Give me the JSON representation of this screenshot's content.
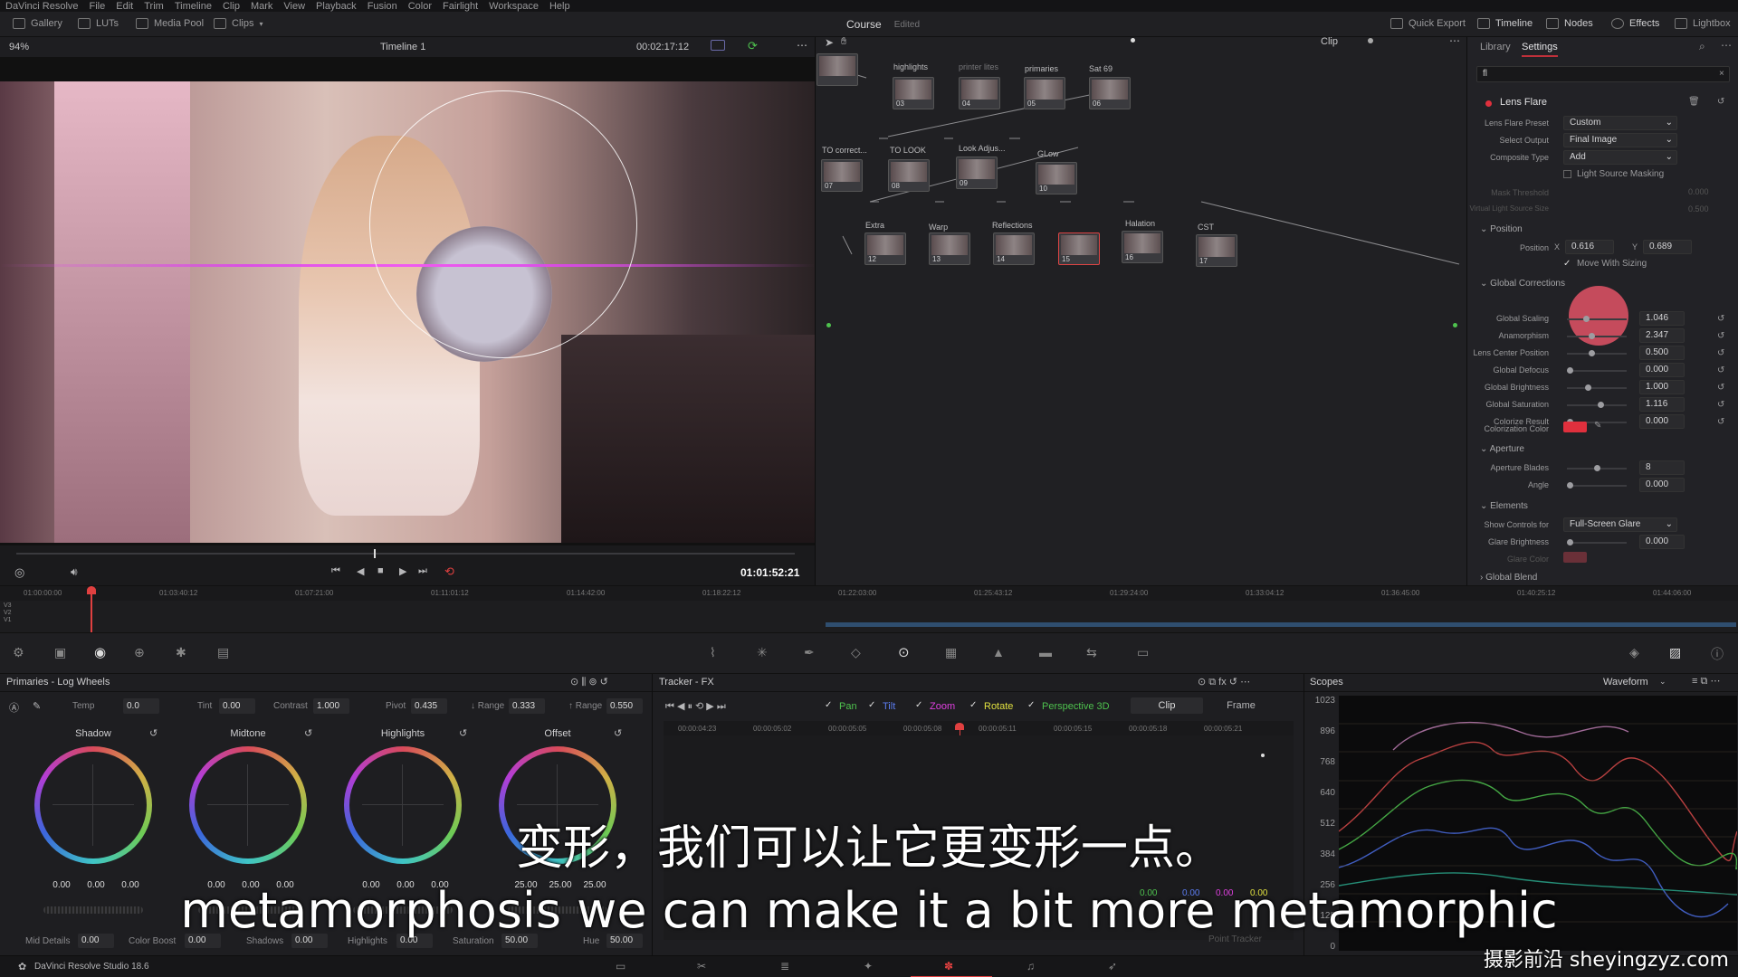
{
  "menu": [
    "DaVinci Resolve",
    "File",
    "Edit",
    "Trim",
    "Timeline",
    "Clip",
    "Mark",
    "View",
    "Playback",
    "Fusion",
    "Color",
    "Fairlight",
    "Workspace",
    "Help"
  ],
  "topbar": {
    "gallery": "Gallery",
    "luts": "LUTs",
    "media_pool": "Media Pool",
    "clips": "Clips",
    "project": "Course",
    "edited": "Edited",
    "quick_export": "Quick Export",
    "timeline": "Timeline",
    "nodes": "Nodes",
    "effects": "Effects",
    "lightbox": "Lightbox"
  },
  "viewer": {
    "zoom": "94%",
    "timeline_name": "Timeline 1",
    "timecode": "00:02:17:12",
    "clip_mode": "Clip",
    "playhead_tc": "01:01:52:21"
  },
  "nodes": [
    {
      "num": "03",
      "label": "highlights"
    },
    {
      "num": "04",
      "label": "printer lites"
    },
    {
      "num": "05",
      "label": "primaries"
    },
    {
      "num": "06",
      "label": "Sat 69"
    },
    {
      "num": "07",
      "label": "TO correct..."
    },
    {
      "num": "08",
      "label": "TO LOOK"
    },
    {
      "num": "09",
      "label": "Look Adjus..."
    },
    {
      "num": "10",
      "label": "GLow"
    },
    {
      "num": "12",
      "label": "Extra"
    },
    {
      "num": "13",
      "label": "Warp"
    },
    {
      "num": "14",
      "label": "Reflections"
    },
    {
      "num": "15",
      "label": ""
    },
    {
      "num": "16",
      "label": "Halation"
    },
    {
      "num": "17",
      "label": "CST"
    }
  ],
  "inspector": {
    "tab_library": "Library",
    "tab_settings": "Settings",
    "search": "fl",
    "effect": "Lens Flare",
    "preset_label": "Lens Flare Preset",
    "preset": "Custom",
    "output_label": "Select Output",
    "output": "Final Image",
    "composite_label": "Composite Type",
    "composite": "Add",
    "light_source": "Light Source Masking",
    "mask_threshold": "Mask Threshold",
    "mask_threshold_val": "0.000",
    "virtual_size": "Virtual Light Source Size",
    "virtual_size_val": "0.500",
    "position_section": "Position",
    "position_label": "Position",
    "x": "0.616",
    "y": "0.689",
    "move_with_sizing": "Move With Sizing",
    "global_section": "Global Corrections",
    "rows": [
      {
        "label": "Global Scaling",
        "value": "1.046"
      },
      {
        "label": "Anamorphism",
        "value": "2.347"
      },
      {
        "label": "Lens Center Position",
        "value": "0.500"
      },
      {
        "label": "Global Defocus",
        "value": "0.000"
      },
      {
        "label": "Global Brightness",
        "value": "1.000"
      },
      {
        "label": "Global Saturation",
        "value": "1.116"
      },
      {
        "label": "Colorize Result",
        "value": "0.000"
      }
    ],
    "colorization_label": "Colorization Color",
    "colorization_color": "#e0303d",
    "aperture_section": "Aperture",
    "aperture_blades_label": "Aperture Blades",
    "aperture_blades": "8",
    "angle_label": "Angle",
    "angle": "0.000",
    "elements_section": "Elements",
    "show_controls_label": "Show Controls for",
    "show_controls": "Full-Screen Glare",
    "glare_brightness_label": "Glare Brightness",
    "glare_brightness": "0.000",
    "glare_color_label": "Glare Color",
    "global_blend": "Global Blend"
  },
  "minitimeline": {
    "ticks": [
      "01:00:00:00",
      "01:03:40:12",
      "01:07:21:00",
      "01:11:01:12",
      "01:14:42:00",
      "01:18:22:12",
      "01:22:03:00",
      "01:25:43:12",
      "01:29:24:00",
      "01:33:04:12",
      "01:36:45:00",
      "01:40:25:12",
      "01:44:06:00"
    ],
    "tracks": [
      "V3",
      "V2",
      "V1"
    ]
  },
  "primaries": {
    "title": "Primaries - Log Wheels",
    "temp_label": "Temp",
    "temp": "0.0",
    "tint_label": "Tint",
    "tint": "0.00",
    "contrast_label": "Contrast",
    "contrast": "1.000",
    "pivot_label": "Pivot",
    "pivot": "0.435",
    "lrange_label": "↓ Range",
    "lrange": "0.333",
    "hrange_label": "↑ Range",
    "hrange": "0.550",
    "wheels": [
      {
        "name": "Shadow",
        "vals": [
          "0.00",
          "0.00",
          "0.00"
        ]
      },
      {
        "name": "Midtone",
        "vals": [
          "0.00",
          "0.00",
          "0.00"
        ]
      },
      {
        "name": "Highlights",
        "vals": [
          "0.00",
          "0.00",
          "0.00"
        ]
      },
      {
        "name": "Offset",
        "vals": [
          "25.00",
          "25.00",
          "25.00"
        ]
      }
    ],
    "mid_detail_label": "Mid Details",
    "mid_detail": "0.00",
    "color_boost_label": "Color Boost",
    "color_boost": "0.00",
    "shadows_label": "Shadows",
    "shadows": "0.00",
    "highlights_label": "Highlights",
    "highlights": "0.00",
    "saturation_label": "Saturation",
    "saturation": "50.00",
    "hue_label": "Hue",
    "hue": "50.00"
  },
  "tracker": {
    "title": "Tracker - FX",
    "pan": "Pan",
    "tilt": "Tilt",
    "zoom": "Zoom",
    "rotate": "Rotate",
    "perspective": "Perspective 3D",
    "clip": "Clip",
    "frame": "Frame",
    "ticks": [
      "00:00:04:23",
      "00:00:05:02",
      "00:00:05:05",
      "00:00:05:08",
      "00:00:05:11",
      "00:00:05:15",
      "00:00:05:18",
      "00:00:05:21"
    ],
    "readouts": [
      "0.00",
      "0.00",
      "0.00",
      "0.00"
    ],
    "point_tracker": "Point Tracker"
  },
  "scopes": {
    "title": "Scopes",
    "mode": "Waveform",
    "scale": [
      "1023",
      "896",
      "768",
      "640",
      "512",
      "384",
      "256",
      "128",
      "0"
    ]
  },
  "status": {
    "app": "DaVinci Resolve Studio 18.6"
  },
  "subtitles": {
    "zh": "变形，我们可以让它更变形一点。",
    "en": "metamorphosis we can make it a bit more metamorphic"
  },
  "watermark": "摄影前沿 sheyingzyz.com"
}
